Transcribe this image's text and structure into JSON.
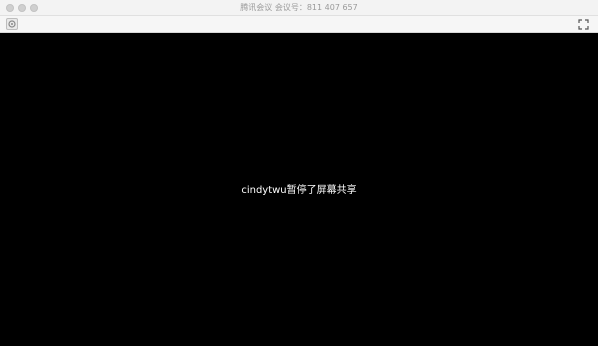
{
  "window": {
    "title": "腾讯会议 会议号：811 407 657"
  },
  "toolbar": {
    "settings_icon": "gear-icon",
    "fullscreen_icon": "fullscreen-icon"
  },
  "share": {
    "status_message": "cindytwu暂停了屏幕共享"
  },
  "colors": {
    "background": "#000000",
    "titlebar": "#f3f3f3",
    "status_text": "#ffffff"
  }
}
